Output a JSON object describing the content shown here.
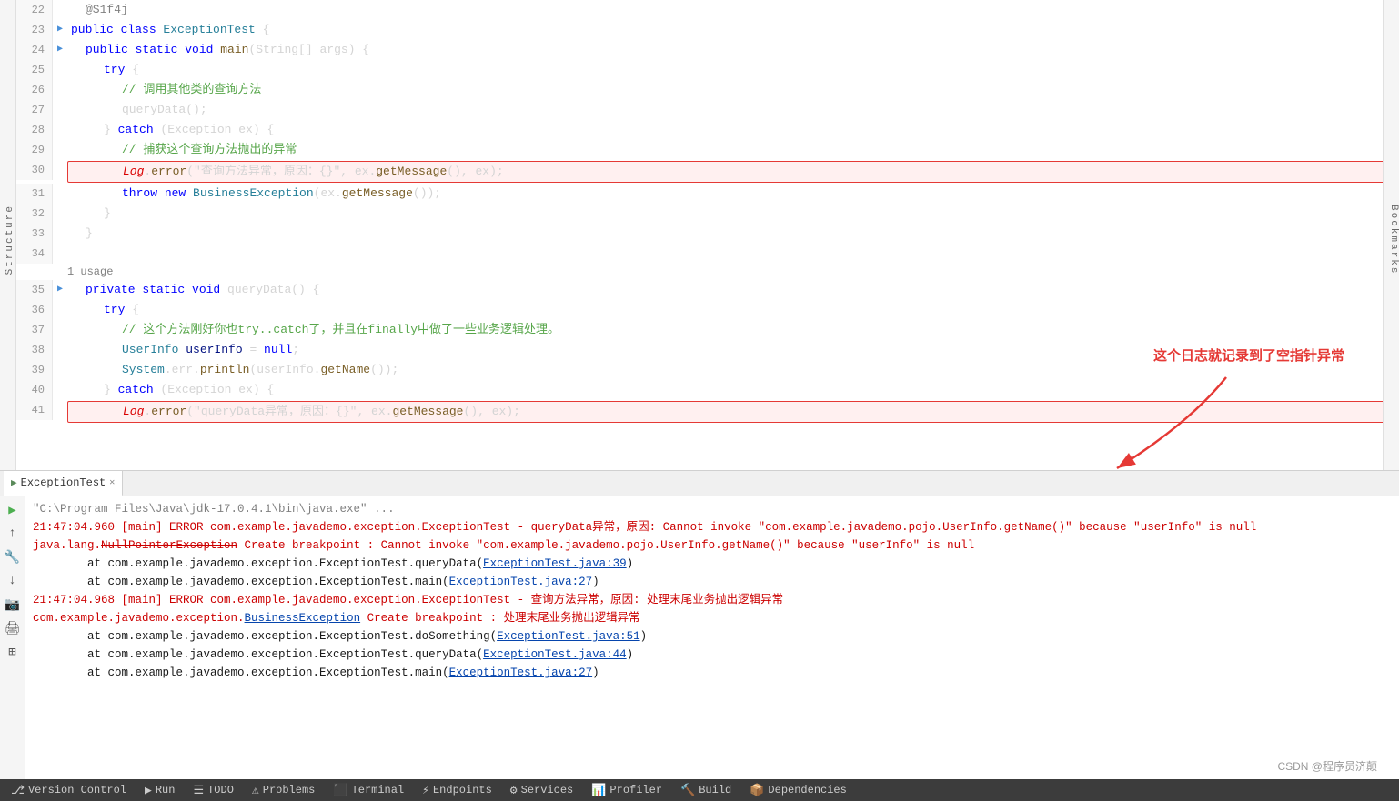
{
  "editor": {
    "lines": [
      {
        "num": "22",
        "arrow": "",
        "indent": "indent1",
        "parts": [
          {
            "text": "@S1f4j",
            "cls": "annotation"
          }
        ]
      },
      {
        "num": "23",
        "arrow": "▶",
        "indent": "",
        "parts": [
          {
            "text": "public ",
            "cls": "kw-blue"
          },
          {
            "text": "class ",
            "cls": "kw-blue"
          },
          {
            "text": "ExceptionTest",
            "cls": "classname"
          },
          {
            "text": " {",
            "cls": ""
          }
        ]
      },
      {
        "num": "24",
        "arrow": "▶",
        "indent": "indent1",
        "parts": [
          {
            "text": "public ",
            "cls": "kw-blue"
          },
          {
            "text": "static ",
            "cls": "kw-blue"
          },
          {
            "text": "void ",
            "cls": "kw-blue"
          },
          {
            "text": "main",
            "cls": "method"
          },
          {
            "text": "(String[] args) {",
            "cls": ""
          }
        ]
      },
      {
        "num": "25",
        "arrow": "",
        "indent": "indent2",
        "parts": [
          {
            "text": "try ",
            "cls": "kw-blue"
          },
          {
            "text": "{",
            "cls": ""
          }
        ]
      },
      {
        "num": "26",
        "arrow": "",
        "indent": "indent3",
        "parts": [
          {
            "text": "// 调用其他类的查询方法",
            "cls": "comment"
          }
        ]
      },
      {
        "num": "27",
        "arrow": "",
        "indent": "indent3",
        "parts": [
          {
            "text": "queryData();",
            "cls": ""
          }
        ]
      },
      {
        "num": "28",
        "arrow": "",
        "indent": "indent2",
        "parts": [
          {
            "text": "} ",
            "cls": ""
          },
          {
            "text": "catch ",
            "cls": "kw-blue"
          },
          {
            "text": "(Exception ex) {",
            "cls": ""
          }
        ]
      },
      {
        "num": "29",
        "arrow": "",
        "indent": "indent3",
        "parts": [
          {
            "text": "// 捕获这个查询方法抛出的异常",
            "cls": "comment"
          }
        ]
      },
      {
        "num": "30",
        "arrow": "",
        "indent": "indent3",
        "highlight": true,
        "parts": [
          {
            "text": "Log",
            "cls": "log-class"
          },
          {
            "text": ".",
            "cls": ""
          },
          {
            "text": "error",
            "cls": "method"
          },
          {
            "text": "(\"查询方法异常，原因：{}\", ex.",
            "cls": ""
          },
          {
            "text": "getMessage",
            "cls": "method"
          },
          {
            "text": "(), ex);",
            "cls": ""
          }
        ]
      },
      {
        "num": "31",
        "arrow": "",
        "indent": "indent3",
        "parts": [
          {
            "text": "throw ",
            "cls": "kw-blue"
          },
          {
            "text": "new ",
            "cls": "kw-blue"
          },
          {
            "text": "BusinessException",
            "cls": "classname"
          },
          {
            "text": "(ex.",
            "cls": ""
          },
          {
            "text": "getMessage",
            "cls": "method"
          },
          {
            "text": "());",
            "cls": ""
          }
        ]
      },
      {
        "num": "32",
        "arrow": "",
        "indent": "indent2",
        "parts": [
          {
            "text": "}",
            "cls": ""
          }
        ]
      },
      {
        "num": "33",
        "arrow": "",
        "indent": "indent1",
        "parts": [
          {
            "text": "}",
            "cls": ""
          }
        ]
      },
      {
        "num": "34",
        "arrow": "",
        "indent": "",
        "parts": []
      },
      {
        "num": "35",
        "arrow": "▶",
        "indent": "indent1",
        "parts": [
          {
            "text": "private ",
            "cls": "kw-blue"
          },
          {
            "text": "static ",
            "cls": "kw-blue"
          },
          {
            "text": "void ",
            "cls": "kw-blue"
          },
          {
            "text": "queryData() {",
            "cls": ""
          }
        ]
      },
      {
        "num": "36",
        "arrow": "",
        "indent": "indent2",
        "parts": [
          {
            "text": "try ",
            "cls": "kw-blue"
          },
          {
            "text": "{",
            "cls": ""
          }
        ]
      },
      {
        "num": "37",
        "arrow": "",
        "indent": "indent3",
        "parts": [
          {
            "text": "// 这个方法刚好你也try..catch了，并且在finally中做了一些业务逻辑处理。",
            "cls": "comment"
          }
        ]
      },
      {
        "num": "38",
        "arrow": "",
        "indent": "indent3",
        "parts": [
          {
            "text": "UserInfo ",
            "cls": "classname"
          },
          {
            "text": "userInfo",
            "cls": "param"
          },
          {
            "text": " = ",
            "cls": ""
          },
          {
            "text": "null",
            "cls": "null-kw"
          },
          {
            "text": ";",
            "cls": ""
          }
        ]
      },
      {
        "num": "39",
        "arrow": "",
        "indent": "indent3",
        "parts": [
          {
            "text": "System",
            "cls": "classname"
          },
          {
            "text": ".err.",
            "cls": ""
          },
          {
            "text": "println",
            "cls": "method"
          },
          {
            "text": "(userInfo.",
            "cls": ""
          },
          {
            "text": "getName",
            "cls": "method"
          },
          {
            "text": "());",
            "cls": ""
          }
        ]
      },
      {
        "num": "40",
        "arrow": "",
        "indent": "indent2",
        "parts": [
          {
            "text": "} ",
            "cls": ""
          },
          {
            "text": "catch ",
            "cls": "kw-blue"
          },
          {
            "text": "(Exception ex) {",
            "cls": ""
          }
        ]
      },
      {
        "num": "41",
        "arrow": "",
        "indent": "indent3",
        "highlight": true,
        "parts": [
          {
            "text": "Log",
            "cls": "log-class"
          },
          {
            "text": ".",
            "cls": ""
          },
          {
            "text": "error",
            "cls": "method"
          },
          {
            "text": "(\"queryData异常，原因：{}\", ex.",
            "cls": ""
          },
          {
            "text": "getMessage",
            "cls": "method"
          },
          {
            "text": "(), ex);",
            "cls": ""
          }
        ]
      }
    ],
    "usage_hint": "1 usage",
    "annotation_text": "这个日志就记录到了空指针异常"
  },
  "run_panel": {
    "tab_label": "ExceptionTest",
    "output_lines": [
      {
        "text": "\"C:\\Program Files\\Java\\jdk-17.0.4.1\\bin\\java.exe\" ...",
        "cls": "output-gray"
      },
      {
        "text": "21:47:04.960 [main] ERROR com.example.javademo.exception.ExceptionTest - queryData异常，原因: Cannot invoke \"com.example.javademo.pojo.UserInfo.getName()\" because \"userInfo\" is null",
        "cls": "output-error"
      },
      {
        "text": "java.lang.NullPointerException Create breakpoint : Cannot invoke \"com.example.javademo.pojo.UserInfo.getName()\" because \"userInfo\" is null",
        "cls": "output-error",
        "has_strikethrough": true,
        "strikethrough_part": "NullPointerException"
      },
      {
        "text": "\tat com.example.javademo.exception.ExceptionTest.queryData(ExceptionTest.java:39)",
        "cls": "output-normal",
        "link": "ExceptionTest.java:39"
      },
      {
        "text": "\tat com.example.javademo.exception.ExceptionTest.main(ExceptionTest.java:27)",
        "cls": "output-normal",
        "link": "ExceptionTest.java:27"
      },
      {
        "text": "21:47:04.968 [main] ERROR com.example.javademo.exception.ExceptionTest - 查询方法异常，原因: 处理末尾业务抛出逻辑异常",
        "cls": "output-error"
      },
      {
        "text": "com.example.javademo.exception.BusinessException Create breakpoint : 处理末尾业务抛出逻辑异常",
        "cls": "output-error",
        "has_link": true,
        "link_part": "BusinessException"
      },
      {
        "text": "\tat com.example.javademo.exception.ExceptionTest.doSomething(ExceptionTest.java:51)",
        "cls": "output-normal",
        "link": "ExceptionTest.java:51"
      },
      {
        "text": "\tat com.example.javademo.exception.ExceptionTest.queryData(ExceptionTest.java:44)",
        "cls": "output-normal",
        "link": "ExceptionTest.java:44"
      },
      {
        "text": "\tat com.example.javademo.exception.ExceptionTest.main(ExceptionTest.java:27)",
        "cls": "output-normal",
        "link": "ExceptionTest.java:27"
      }
    ]
  },
  "status_bar": {
    "items": [
      {
        "icon": "⎇",
        "label": "Version Control"
      },
      {
        "icon": "▶",
        "label": "Run"
      },
      {
        "icon": "☰",
        "label": "TODO"
      },
      {
        "icon": "⚠",
        "label": "Problems"
      },
      {
        "icon": "⬛",
        "label": "Terminal"
      },
      {
        "icon": "⚡",
        "label": "Endpoints"
      },
      {
        "icon": "⚙",
        "label": "Services"
      },
      {
        "icon": "📊",
        "label": "Profiler"
      },
      {
        "icon": "🔨",
        "label": "Build"
      },
      {
        "icon": "📦",
        "label": "Dependencies"
      }
    ],
    "watermark": "CSDN @程序员济颠"
  }
}
